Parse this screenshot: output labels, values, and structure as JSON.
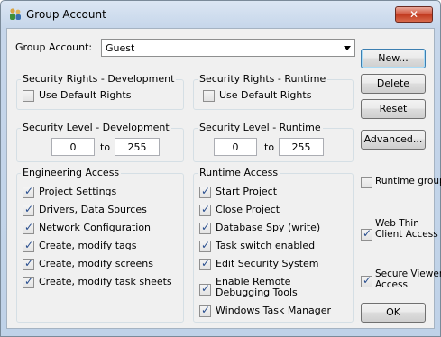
{
  "window": {
    "title": "Group Account",
    "close_label": "✕",
    "icon": "users-group-icon"
  },
  "group_account": {
    "label": "Group Account:",
    "value": "Guest"
  },
  "security_rights_dev": {
    "title": "Security Rights - Development",
    "checkbox_label": "Use Default Rights",
    "checked": false
  },
  "security_rights_rt": {
    "title": "Security Rights - Runtime",
    "checkbox_label": "Use Default Rights",
    "checked": false
  },
  "security_level_dev": {
    "title": "Security Level - Development",
    "from": "0",
    "to_label": "to",
    "to": "255"
  },
  "security_level_rt": {
    "title": "Security Level - Runtime",
    "from": "0",
    "to_label": "to",
    "to": "255"
  },
  "engineering_access": {
    "title": "Engineering Access",
    "items": [
      {
        "label": "Project Settings",
        "checked": true
      },
      {
        "label": "Drivers, Data Sources",
        "checked": true
      },
      {
        "label": "Network Configuration",
        "checked": true
      },
      {
        "label": "Create, modify tags",
        "checked": true
      },
      {
        "label": "Create, modify screens",
        "checked": true
      },
      {
        "label": "Create, modify task sheets",
        "checked": true
      }
    ]
  },
  "runtime_access": {
    "title": "Runtime Access",
    "items": [
      {
        "label": "Start Project",
        "checked": true
      },
      {
        "label": "Close Project",
        "checked": true
      },
      {
        "label": "Database Spy (write)",
        "checked": true
      },
      {
        "label": "Task switch enabled",
        "checked": true
      },
      {
        "label": "Edit Security System",
        "checked": true
      },
      {
        "label_line1": "Enable Remote",
        "label_line2": "Debugging Tools",
        "checked": true
      },
      {
        "label": "Windows Task Manager",
        "checked": true
      }
    ]
  },
  "side_options": {
    "runtime_group": {
      "label": "Runtime group",
      "checked": false
    },
    "web_thin_client": {
      "label_line1": "Web Thin",
      "label_line2": "Client Access",
      "checked": true
    },
    "secure_viewer": {
      "label_line1": "Secure Viewer",
      "label_line2": "Access",
      "checked": true
    }
  },
  "buttons": {
    "new": "New...",
    "delete": "Delete",
    "reset": "Reset",
    "advanced": "Advanced...",
    "ok": "OK"
  }
}
